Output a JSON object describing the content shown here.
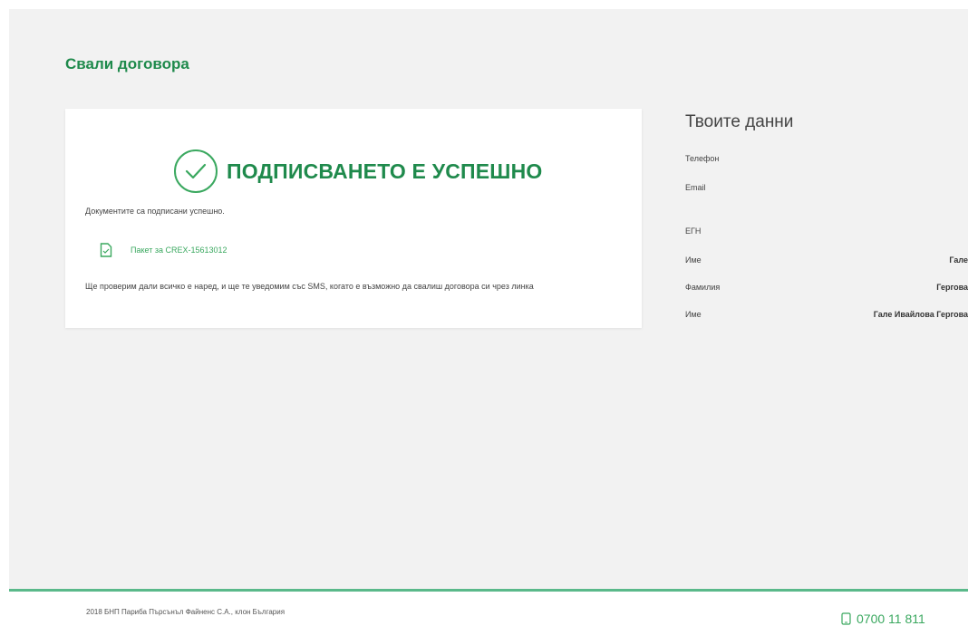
{
  "page": {
    "title": "Свали договора"
  },
  "card": {
    "success_title": "ПОДПИСВАНЕТО Е УСПЕШНО",
    "documents_text": "Документите са подписани успешно.",
    "document_link": "Пакет за CREX-15613012",
    "info_text": "Ще проверим дали всичко е наред, и ще те уведомим със SMS, когато е възможно да свалиш договора си чрез линка"
  },
  "sidebar": {
    "title": "Твоите данни",
    "fields": [
      {
        "label": "Телефон",
        "value": ""
      },
      {
        "label": "Email",
        "value": ""
      },
      {
        "label": "ЕГН",
        "value": ""
      },
      {
        "label": "Име",
        "value": "Гале"
      },
      {
        "label": "Фамилия",
        "value": "Гергова"
      },
      {
        "label": "Име",
        "value": "Гале Ивайлова Гергова"
      }
    ]
  },
  "footer": {
    "copyright": "2018 БНП Париба Пърсънъл Файненс С.А., клон България",
    "phone": "0700 11 811"
  },
  "colors": {
    "accent": "#1f8a4c",
    "accent_light": "#3aa85f",
    "footer_line": "#5ab98a",
    "background": "#f2f2f2"
  },
  "icons": {
    "success": "check-circle-icon",
    "document": "file-icon",
    "phone": "phone-icon"
  }
}
